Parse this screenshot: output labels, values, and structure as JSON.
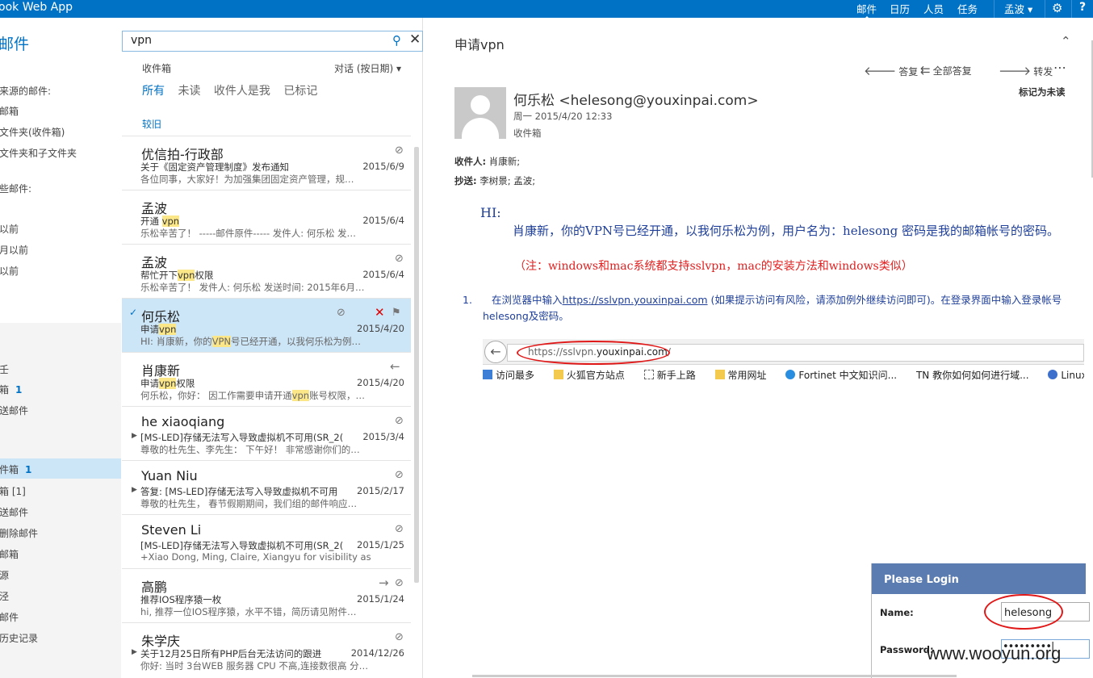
{
  "topbar": {
    "app_title": "ook Web App",
    "nav": [
      "邮件",
      "日历",
      "人员",
      "任务"
    ],
    "user": "孟波 ▾",
    "settings_icon": "gear-icon",
    "help_label": "?"
  },
  "left_pane": {
    "header": "邮件",
    "items": [
      {
        "label": "来源的邮件:"
      },
      {
        "label": "邮箱"
      },
      {
        "label": "文件夹(收件箱)"
      },
      {
        "label": "文件夹和子文件夹"
      },
      {
        "label": "些邮件:"
      },
      {
        "label": ""
      },
      {
        "label": "以前"
      },
      {
        "label": "月以前"
      },
      {
        "label": "以前"
      },
      {
        "label": "壬"
      },
      {
        "label": "箱",
        "count": "1"
      },
      {
        "label": "送邮件"
      },
      {
        "label": "件箱",
        "count": "1"
      },
      {
        "label": "箱 [1]"
      },
      {
        "label": "送邮件"
      },
      {
        "label": "删除邮件"
      },
      {
        "label": "邮箱"
      },
      {
        "label": "源"
      },
      {
        "label": "泾"
      },
      {
        "label": "邮件"
      },
      {
        "label": "历史记录"
      }
    ]
  },
  "search": {
    "value": "vpn"
  },
  "list": {
    "folder": "收件箱",
    "sort": "对话 (按日期)",
    "filters": [
      "所有",
      "未读",
      "收件人是我",
      "已标记"
    ],
    "group": "较旧",
    "messages": [
      {
        "from": "优信拍-行政部",
        "subject": "关于《固定资产管理制度》发布通知",
        "date": "2015/6/9",
        "preview": "各位同事，大家好！为加强集团固定资产管理，规…"
      },
      {
        "from": "孟波",
        "subject_parts": [
          "开通 ",
          "vpn",
          ""
        ],
        "date": "2015/6/4",
        "preview": "乐松辛苦了！ -----邮件原件----- 发件人: 何乐松 发…"
      },
      {
        "from": "孟波",
        "subject_parts": [
          "帮忙开下",
          "vpn",
          "权限"
        ],
        "date": "2015/6/4",
        "preview": "乐松辛苦了！  发件人: 何乐松 发送时间: 2015年6月…"
      },
      {
        "from": "何乐松",
        "subject_parts": [
          "申请",
          "vpn",
          ""
        ],
        "date": "2015/4/20",
        "preview_parts": [
          "HI: 肖康新，你的",
          "VPN",
          "号已经开通，以我何乐松为例…"
        ]
      },
      {
        "from": "肖康新",
        "subject_parts": [
          "申请",
          "vpn",
          "权限"
        ],
        "date": "2015/4/20",
        "preview_parts": [
          "何乐松，你好：  因工作需要申请开通",
          "vpn",
          "账号权限，…"
        ]
      },
      {
        "from": "he xiaoqiang",
        "subject": "[MS-LED]存储无法写入导致虚拟机不可用(SR_2(",
        "date": "2015/3/4",
        "preview": "尊敬的杜先生、李先生：  下午好！  非常感谢你们的…"
      },
      {
        "from": "Yuan Niu",
        "subject": "答复: [MS-LED]存储无法写入导致虚拟机不可用",
        "date": "2015/2/17",
        "preview": "尊敬的杜先生，  春节假期期间，我们组的邮件响应…"
      },
      {
        "from": "Steven Li",
        "subject": "[MS-LED]存储无法写入导致虚拟机不可用(SR_2(",
        "date": "2015/1/25",
        "preview": "+Xiao Dong, Ming, Claire, Xiangyu for visibility as Sh…"
      },
      {
        "from": "高鹏",
        "subject": "推荐IOS程序猿一枚",
        "date": "2015/1/24",
        "preview": "hi,  推荐一位IOS程序猿，水平不错，简历请见附件…"
      },
      {
        "from": "朱学庆",
        "subject": "关于12月25日所有PHP后台无法访问的跟进",
        "date": "2014/12/26",
        "preview": "你好: 当时 3台WEB 服务器 CPU 不高,连接数很高 分…"
      }
    ]
  },
  "reading": {
    "subject": "申请vpn",
    "actions": [
      "答复",
      "全部答复",
      "转发"
    ],
    "sender": "何乐松 <helesong@youxinpai.com>",
    "sent": "周一 2015/4/20 12:33",
    "folder": "收件箱",
    "mark_unread": "标记为未读",
    "to_label": "收件人:",
    "to_value": "肖康新;",
    "cc_label": "抄送:",
    "cc_value": "李树景;  孟波;",
    "body_hi": "HI:",
    "body_p1": "肖康新，你的VPN号已经开通，以我何乐松为例，用户名为：helesong   密码是我的邮箱帐号的密码。",
    "body_note": "（注：windows和mac系统都支持sslvpn，mac的安装方法和windows类似）",
    "step_num": "1.",
    "step_before": "在浏览器中输入",
    "step_link": "https://sslvpn.youxinpai.com",
    "step_after": " (如果提示访问有风险，请添加例外继续访问即可)。在登录界面中输入登录帐号 helesong及密码。",
    "url_prefix": "https://sslvpn.",
    "url_domain": "youxinpai.com",
    "bookmarks": [
      "访问最多",
      "火狐官方站点",
      "新手上路",
      "常用网址",
      "Fortinet 中文知识问...",
      "TN 教你如何如何进行域...",
      "Linux下时间/时"
    ],
    "login_title": "Please Login",
    "login_name_label": "Name:",
    "login_name_value": "helesong",
    "login_pass_label": "Password:",
    "login_pass_value": "•••••••••|"
  },
  "watermark": "www.wooyun.org"
}
